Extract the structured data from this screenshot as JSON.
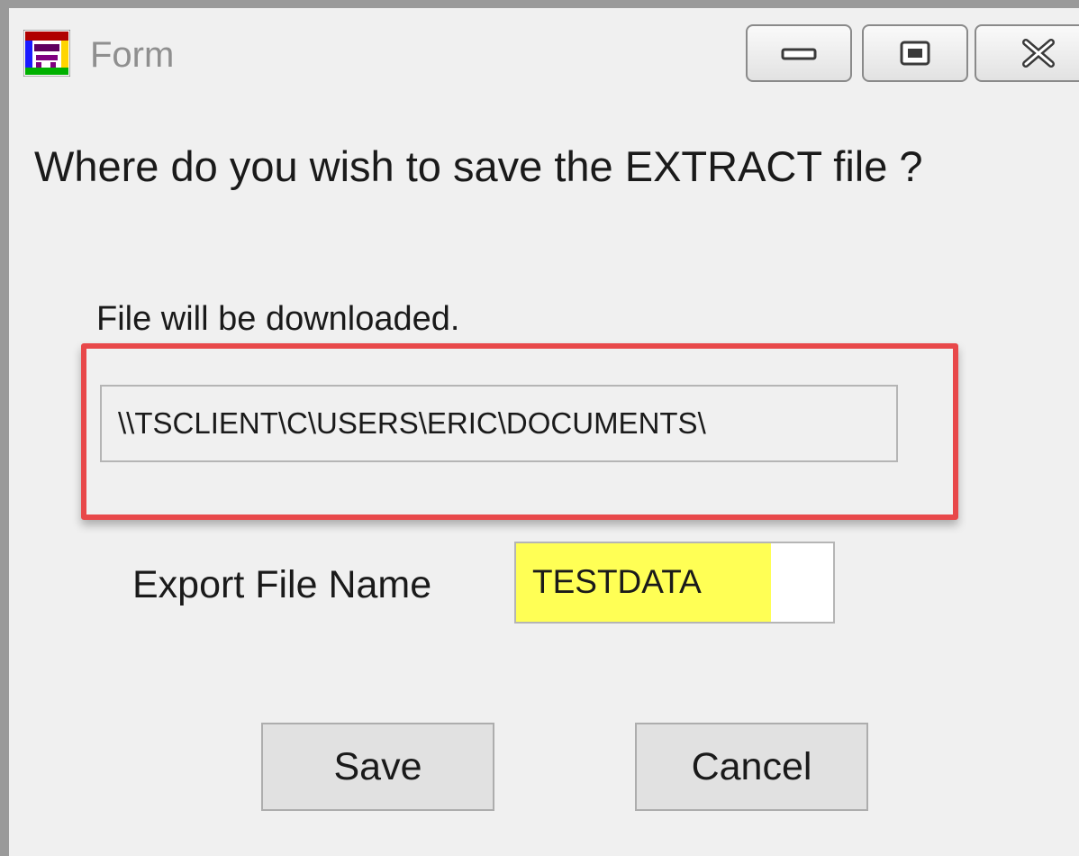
{
  "window": {
    "title": "Form"
  },
  "dialog": {
    "prompt": "Where do you wish to save the EXTRACT file ?",
    "download_note": "File will be downloaded.",
    "path_value": "\\\\TSCLIENT\\C\\USERS\\ERIC\\DOCUMENTS\\",
    "export_label": "Export File Name",
    "export_value": "TESTDATA",
    "save_label": "Save",
    "cancel_label": "Cancel"
  },
  "icons": {
    "app": "form-app-icon",
    "minimize": "minimize-icon",
    "maximize": "maximize-icon",
    "close": "close-icon"
  },
  "colors": {
    "highlight_border": "#e8484a",
    "export_field_fill": "#ffff55",
    "window_background": "#f0f0f0",
    "title_text": "#8f8f8f"
  }
}
